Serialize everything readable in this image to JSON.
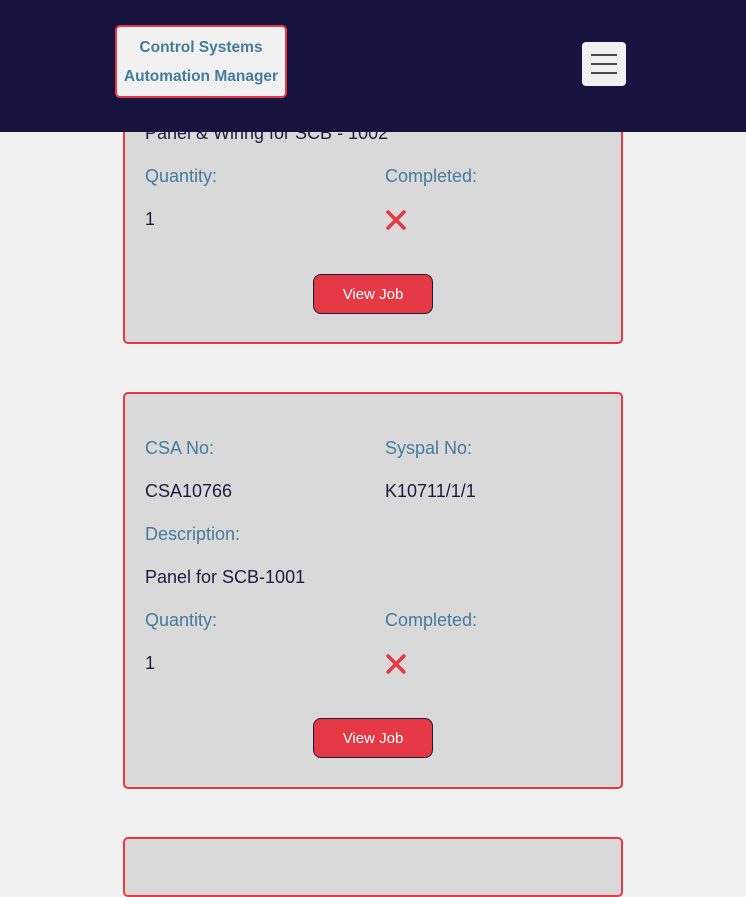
{
  "header": {
    "brand_line1": "Control Systems",
    "brand_line2": "Automation Manager",
    "menu_icon": "hamburger-menu-icon"
  },
  "jobs": [
    {
      "description_value": "Panel & Wiring for SCB - 1002",
      "quantity_label": "Quantity:",
      "quantity_value": "1",
      "completed_label": "Completed:",
      "completed_icon": "cross-mark-icon",
      "view_button": "View Job"
    },
    {
      "csa_label": "CSA No:",
      "csa_value": "CSA10766",
      "syspal_label": "Syspal No:",
      "syspal_value": "K10711/1/1",
      "description_label": "Description:",
      "description_value": "Panel for SCB-1001",
      "quantity_label": "Quantity:",
      "quantity_value": "1",
      "completed_label": "Completed:",
      "completed_icon": "cross-mark-icon",
      "view_button": "View Job"
    }
  ],
  "colors": {
    "navbar": "#16143f",
    "accent": "#e63946",
    "label": "#457b9d",
    "card": "#d9d9d9",
    "text": "#1d1b3f",
    "background": "#f1f1f1"
  }
}
